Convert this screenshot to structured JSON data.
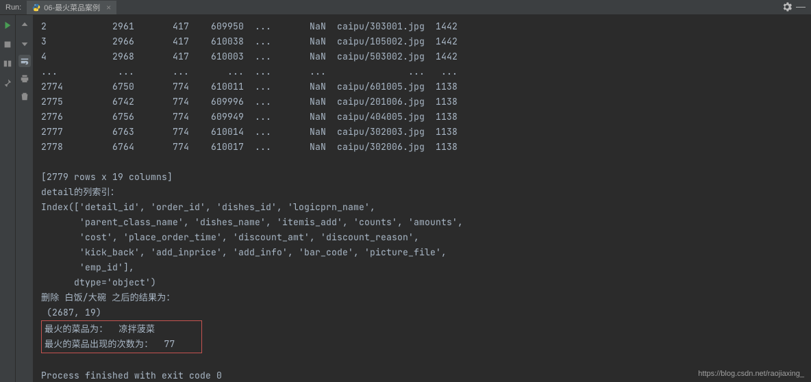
{
  "top": {
    "run_label": "Run:",
    "tab_title": "06-最火菜品案例"
  },
  "console": {
    "rows": [
      "2            2961       417    609950  ...       NaN  caipu/303001.jpg  1442",
      "3            2966       417    610038  ...       NaN  caipu/105002.jpg  1442",
      "4            2968       417    610003  ...       NaN  caipu/503002.jpg  1442",
      "...           ...       ...       ...  ...       ...               ...   ...",
      "2774         6750       774    610011  ...       NaN  caipu/601005.jpg  1138",
      "2775         6742       774    609996  ...       NaN  caipu/201006.jpg  1138",
      "2776         6756       774    609949  ...       NaN  caipu/404005.jpg  1138",
      "2777         6763       774    610014  ...       NaN  caipu/302003.jpg  1138",
      "2778         6764       774    610017  ...       NaN  caipu/302006.jpg  1138"
    ],
    "summary": "[2779 rows x 19 columns]",
    "detail_label": "detail的列索引：",
    "index_lines": [
      "Index(['detail_id', 'order_id', 'dishes_id', 'logicprn_name',",
      "       'parent_class_name', 'dishes_name', 'itemis_add', 'counts', 'amounts',",
      "       'cost', 'place_order_time', 'discount_amt', 'discount_reason',",
      "       'kick_back', 'add_inprice', 'add_info', 'bar_code', 'picture_file',",
      "       'emp_id'],",
      "      dtype='object')"
    ],
    "delete_label": "删除 白饭/大碗 之后的结果为：",
    "shape": " (2687, 19)",
    "hotline1": "最火的菜品为：  凉拌菠菜        ",
    "hotline2": "最火的菜品出现的次数为：  77 ",
    "exit_line": "Process finished with exit code 0"
  },
  "watermark": "https://blog.csdn.net/raojiaxing_"
}
